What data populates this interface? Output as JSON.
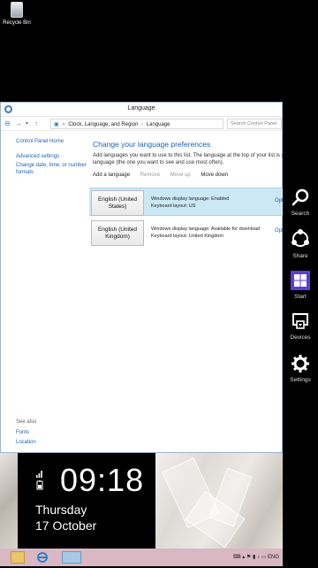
{
  "desktop": {
    "recycle_bin_label": "Recycle Bin"
  },
  "window": {
    "title": "Language",
    "address": {
      "root": "Clock, Language, and Region",
      "leaf": "Language"
    },
    "search_placeholder": "Search Control Panel"
  },
  "left_nav": {
    "home": "Control Panel Home",
    "advanced": "Advanced settings",
    "change_date": "Change date, time, or number formats",
    "see_also": "See also",
    "fonts": "Fonts",
    "location": "Location"
  },
  "main": {
    "heading": "Change your language preferences",
    "desc_line1": "Add languages you want to use to this list. The language at the top of your list is your p",
    "desc_line2": "language (the one you want to see and use most often).",
    "toolbar": {
      "add": "Add a language",
      "remove": "Remove",
      "move_up": "Move up",
      "move_down": "Move down"
    },
    "languages": [
      {
        "name_line1": "English (United",
        "name_line2": "States)",
        "display": "Windows display language: Enabled",
        "keyboard": "Keyboard layout: US",
        "options": "Opt"
      },
      {
        "name_line1": "English (United",
        "name_line2": "Kingdom)",
        "display": "Windows display language: Available for download",
        "keyboard": "Keyboard layout: United Kingdom",
        "options": "Opt"
      }
    ]
  },
  "charms": {
    "search": "Search",
    "share": "Share",
    "start": "Start",
    "devices": "Devices",
    "settings": "Settings"
  },
  "clock": {
    "time": "09:18",
    "day": "Thursday",
    "date": "17 October"
  },
  "taskbar": {
    "lang": "ENG"
  },
  "colors": {
    "accent": "#1f62b3",
    "start_tile": "#5a3fd0",
    "selection": "#cde8f5"
  }
}
